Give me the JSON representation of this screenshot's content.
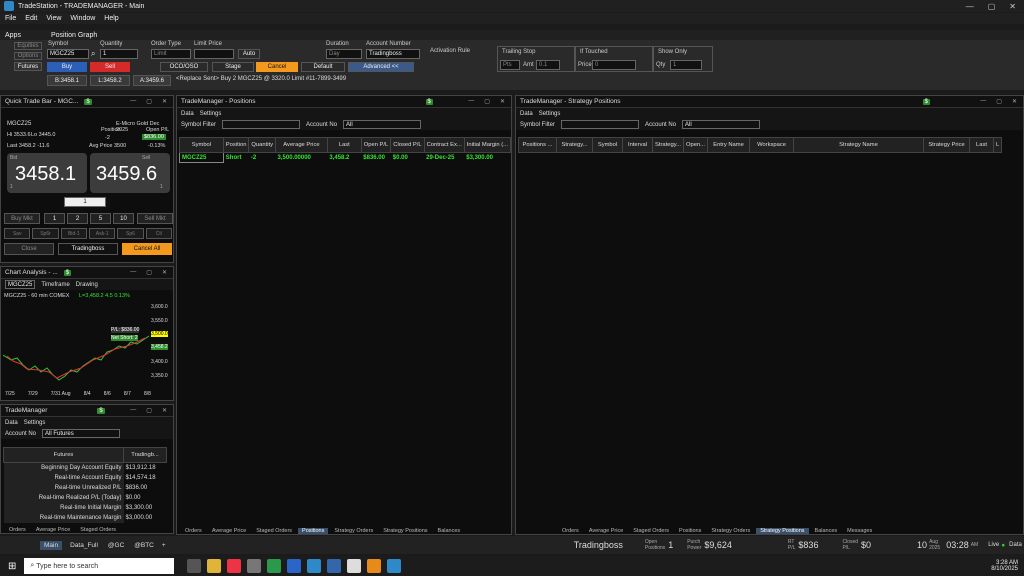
{
  "app": {
    "title": "TradeStation - TRADEMANAGER - Main"
  },
  "menu": [
    "File",
    "Edit",
    "View",
    "Window",
    "Help"
  ],
  "subnav": {
    "apps": "Apps",
    "graph": "Position Graph"
  },
  "tradebar": {
    "side_tabs": [
      "Equities",
      "Options",
      "Futures"
    ],
    "symbol_label": "Symbol",
    "symbol": "MGCZ25",
    "qty_label": "Quantity",
    "qty": "1",
    "order_type_label": "Order Type",
    "order_type": "Limit",
    "limit_label": "Limit Price",
    "limit": "",
    "auto": "Auto",
    "buy": "Buy",
    "sell": "Sell",
    "bid": "B:3458.1",
    "last": "L:3458.2",
    "ask": "A:3459.6",
    "oco": "OCO/OSO",
    "stage": "Stage",
    "cancel": "Cancel",
    "default": "Default",
    "duration_label": "Duration",
    "duration": "Day",
    "account_label": "Account Number",
    "account": "Tradingboss",
    "advanced": "Advanced <<",
    "activation": "Activation Rule",
    "trailing": "Trailing Stop",
    "pts": "Pts",
    "amt": "Amt",
    "amt_val": "0.1",
    "iftouched": "If Touched",
    "price": "Price",
    "price_val": "0",
    "showonly": "Show Only",
    "qtyl": "Qty",
    "qty_val": "1",
    "status": "<Replace Sent> Buy 2 MGCZ25 @ 3320.0 Limit #11-7899-3499"
  },
  "qtb": {
    "title": "Quick Trade Bar - MGC...",
    "badge": "$",
    "symbol": "MGCZ25",
    "desc": "E-Micro Gold Dec 2025",
    "hi": "Hi 3533.6",
    "lo": "Lo 3445.0",
    "position_label": "Position",
    "position": "-2",
    "openpl_label": "Open P/L",
    "openpl": "$836.00",
    "last_line": "Last 3458.2  -11.6",
    "avg": "Avg Price 3500",
    "pct": "-0.13%",
    "bid_label": "Bid",
    "bid": "3458.1",
    "ask_label": "Sell",
    "ask": "3459.6",
    "bidsz": "1",
    "asksz": "1",
    "qty": "1",
    "buy_mkt": "Buy Mkt",
    "n1": "1",
    "n2": "2",
    "n5": "5",
    "n10": "10",
    "sell_mkt": "Sell Mkt",
    "r2": [
      "Sav",
      "Sp6r",
      "Bid-1",
      "Ask-1",
      "Sp6",
      "Ctl"
    ],
    "close": "Close",
    "account": "Tradingboss",
    "cancel_all": "Cancel All"
  },
  "chart": {
    "title": "Chart Analysis - ...",
    "badge": "$",
    "symbol": "MGCZ25",
    "timeframe": "Timeframe",
    "drawing": "Drawing",
    "info": "MGCZ25 - 60 min  COMEX",
    "ohlc": "L=3,458.2  4.5  0.13%",
    "prices": [
      "3,600.0",
      "3,550.0",
      "3,500.0",
      "3,450.0",
      "3,400.0",
      "3,350.0"
    ],
    "price_flag1": "3,500.0",
    "price_flag2": "3,458.2",
    "pl_tag": "P/L: $836.00",
    "net_tag": "Net Short: 2",
    "dates": [
      "7/25",
      "7/29",
      "7/31 Aug",
      "8/4",
      "8/6",
      "8/7",
      "8/8"
    ]
  },
  "tm_small": {
    "title": "TradeManager",
    "badge": "$",
    "data": "Data",
    "settings": "Settings",
    "acct_label": "Account No",
    "acct": "All Futures",
    "hdr1": "Futures",
    "hdr2": "Tradingb...",
    "rows": [
      [
        "Beginning Day Account Equity",
        "$13,912.18"
      ],
      [
        "Real-time Account Equity",
        "$14,574.18"
      ],
      [
        "Real-time Unrealized P/L",
        "$836.00"
      ],
      [
        "Real-time Realized P/L (Today)",
        "$0.00"
      ],
      [
        "Real-time Initial Margin",
        "$3,300.00"
      ],
      [
        "Real-time Maintenance Margin",
        "$3,000.00"
      ]
    ]
  },
  "positions": {
    "title": "TradeManager - Positions",
    "badge": "$",
    "data": "Data",
    "settings": "Settings",
    "filter": "Symbol Filter",
    "acct_label": "Account No",
    "acct": "All",
    "cols": [
      "Symbol",
      "Position",
      "Quantity",
      "Average Price",
      "Last",
      "Open P/L",
      "Closed P/L",
      "Contract Ex...",
      "Initial Margin (..."
    ],
    "row": [
      "MGCZ25",
      "Short",
      "-2",
      "3,500.00000",
      "3,458.2",
      "$836.00",
      "$0.00",
      "29-Dec-25",
      "$3,300.00"
    ],
    "tabs": [
      "Orders",
      "Average Price",
      "Staged Orders",
      "Positions",
      "Strategy Orders",
      "Strategy Positions",
      "Balances"
    ]
  },
  "strategy": {
    "title": "TradeManager - Strategy Positions",
    "badge": "$",
    "data": "Data",
    "settings": "Settings",
    "filter": "Symbol Filter",
    "acct_label": "Account No",
    "acct": "All",
    "cols": [
      "Positions ...",
      "Strategy...",
      "Symbol",
      "Interval",
      "Strategy...",
      "Open...",
      "Entry Name",
      "Workspace",
      "Strategy Name",
      "Strategy Price",
      "Last",
      "L"
    ],
    "tabs": [
      "Orders",
      "Average Price",
      "Staged Orders",
      "Positions",
      "Strategy Orders",
      "Strategy Positions",
      "Balances",
      "Messages"
    ]
  },
  "tm_small_tabs": [
    "Orders",
    "Average Price",
    "Staged Orders"
  ],
  "bottom": {
    "tabs": [
      "Main",
      "Data_Full",
      "@GC",
      "@BTC"
    ],
    "account": "Tradingboss",
    "open_label": "Open Positions",
    "open": "1",
    "purch_label": "Purch Power",
    "purch": "$9,624",
    "rt_label": "RT P/L",
    "rt": "$836",
    "closed_label": "Closed P/L",
    "closed": "$0",
    "date_num": "10",
    "date_sub": "Aug 2025",
    "time": "03:28",
    "ampm": "AM",
    "live": "Live",
    "data": "Data"
  },
  "taskbar": {
    "search": "Type here to search",
    "time": "3:28 AM",
    "date": "8/10/2025"
  },
  "colors": {
    "buy": "#2b5fb8",
    "sell": "#d42a2a",
    "orange": "#f39a1e",
    "green": "#2e8b2e"
  }
}
